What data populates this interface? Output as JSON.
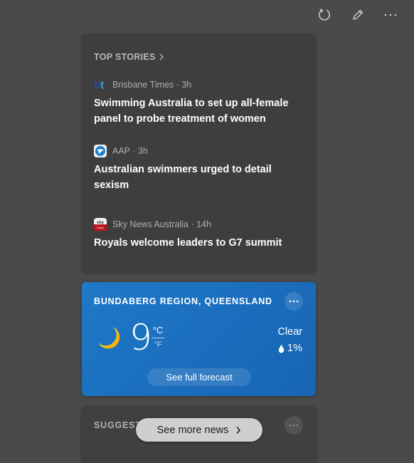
{
  "toolbar": {
    "refresh_icon": "refresh-icon",
    "edit_icon": "pencil-icon",
    "more_icon": "more-horizontal-icon"
  },
  "top_stories": {
    "title": "TOP STORIES",
    "chevron_icon": "chevron-right-icon",
    "stories": [
      {
        "source": "Brisbane Times",
        "age": "3h",
        "meta": "Brisbane Times · 3h",
        "logo_icon": "brisbane-times-logo",
        "title": "Swimming Australia to set up all-female panel to probe treatment of women"
      },
      {
        "source": "AAP",
        "age": "3h",
        "meta": "AAP · 3h",
        "logo_icon": "aap-logo",
        "title": "Australian swimmers urged to detail sexism"
      },
      {
        "source": "Sky News Australia",
        "age": "14h",
        "meta": "Sky News Australia · 14h",
        "logo_icon": "sky-news-logo",
        "title": "Royals welcome leaders to G7 summit"
      }
    ]
  },
  "weather": {
    "location": "BUNDABERG REGION, QUEENSLAND",
    "temperature": "9",
    "unit_celsius": "°C",
    "unit_fahrenheit": "°F",
    "condition": "Clear",
    "precipitation": "1%",
    "condition_icon": "moon-icon",
    "forecast_button": "See full forecast",
    "colors": {
      "card_top": "#1f78c8",
      "card_bottom": "#1765b4"
    }
  },
  "suggested": {
    "title": "SUGGEST"
  },
  "see_more_news": {
    "label": "See more news"
  }
}
